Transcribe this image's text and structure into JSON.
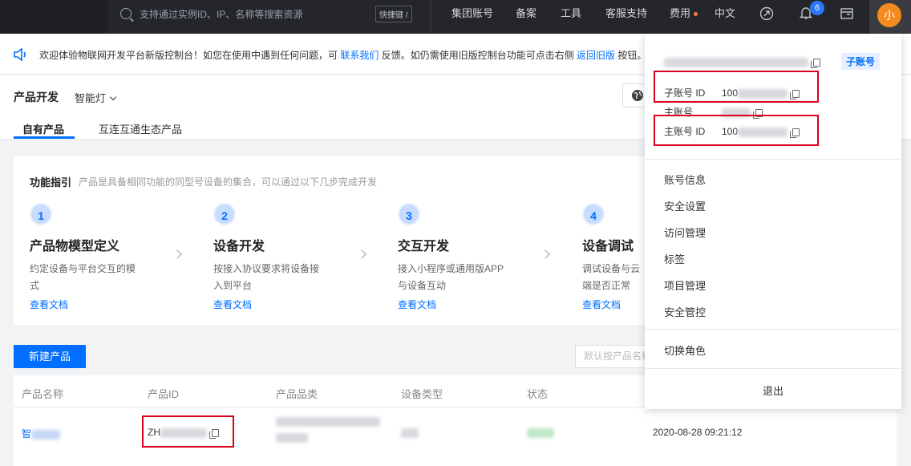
{
  "topbar": {
    "search_placeholder": "支持通过实例ID、IP、名称等搜索资源",
    "shortcut_label": "快捷键 /",
    "nav": [
      "集团账号",
      "备案",
      "工具",
      "客服支持",
      "费用",
      "中文"
    ],
    "notification_count": "6",
    "avatar_text": "小"
  },
  "notice": {
    "text_1": "欢迎体验物联网开发平台新版控制台！如您在使用中遇到任何问题，可 ",
    "link_contact": "联系我们",
    "text_2": " 反馈。如仍需使用旧版控制台功能可点击右侧 ",
    "link_back": "返回旧版",
    "text_3": " 按钮。"
  },
  "product_header": {
    "title": "产品开发",
    "project": "智能灯",
    "tabs": [
      "自有产品",
      "互连互通生态产品"
    ]
  },
  "guide": {
    "title": "功能指引",
    "subtitle": "产品是具备相同功能的同型号设备的集合，可以通过以下几步完成开发",
    "steps": [
      {
        "num": "1",
        "title": "产品物模型定义",
        "desc": "约定设备与平台交互的模式",
        "doc": "查看文档"
      },
      {
        "num": "2",
        "title": "设备开发",
        "desc": "按接入协议要求将设备接入到平台",
        "doc": "查看文档"
      },
      {
        "num": "3",
        "title": "交互开发",
        "desc": "接入小程序或通用版APP与设备互动",
        "doc": "查看文档"
      },
      {
        "num": "4",
        "title": "设备调试",
        "desc": "调试设备与云端是否正常",
        "doc": "查看文档"
      }
    ]
  },
  "actions": {
    "new_product": "新建产品",
    "filter_placeholder": "默认按产品名称"
  },
  "table": {
    "headers": [
      "产品名称",
      "产品ID",
      "产品品类",
      "设备类型",
      "状态"
    ],
    "row": {
      "name_prefix": "智",
      "id_prefix": "ZH",
      "created": "2020-08-28 09:21:12"
    }
  },
  "account_menu": {
    "sub_account_tag": "子账号",
    "sub_account_id_label": "子账号 ID",
    "sub_account_id_prefix": "100",
    "main_account_label": "主账号",
    "main_account_id_label": "主账号 ID",
    "main_account_id_prefix": "100",
    "items": [
      "账号信息",
      "安全设置",
      "访问管理",
      "标签",
      "项目管理",
      "安全管控"
    ],
    "switch_role": "切换角色",
    "logout": "退出"
  },
  "colors": {
    "accent": "#006eff",
    "highlight_box": "#d9001b",
    "avatar": "#f58a1f",
    "topbar": "#24262b"
  }
}
